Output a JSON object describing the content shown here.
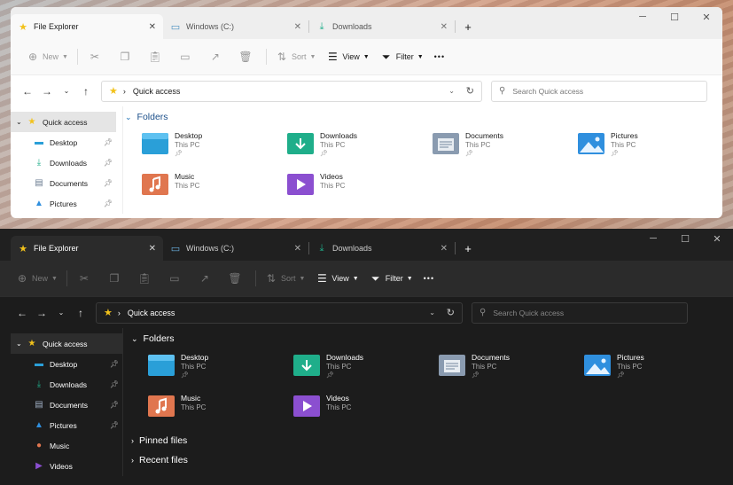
{
  "tabs": [
    {
      "label": "File Explorer",
      "icon": "star-icon",
      "active": true
    },
    {
      "label": "Windows (C:)",
      "icon": "drive-icon",
      "active": false
    },
    {
      "label": "Downloads",
      "icon": "download-icon",
      "active": false
    }
  ],
  "toolbar": {
    "new_label": "New",
    "sort_label": "Sort",
    "view_label": "View",
    "filter_label": "Filter",
    "more_label": "•••"
  },
  "address": {
    "location": "Quick access",
    "search_placeholder": "Search Quick access"
  },
  "sidebar": {
    "root": "Quick access",
    "items_light": [
      {
        "label": "Desktop",
        "icon": "desktop-icon"
      },
      {
        "label": "Downloads",
        "icon": "download-icon"
      },
      {
        "label": "Documents",
        "icon": "document-icon"
      },
      {
        "label": "Pictures",
        "icon": "pictures-icon"
      }
    ],
    "items_dark": [
      {
        "label": "Desktop",
        "icon": "desktop-icon"
      },
      {
        "label": "Downloads",
        "icon": "download-icon"
      },
      {
        "label": "Documents",
        "icon": "document-icon"
      },
      {
        "label": "Pictures",
        "icon": "pictures-icon"
      },
      {
        "label": "Music",
        "icon": "music-icon"
      },
      {
        "label": "Videos",
        "icon": "videos-icon"
      }
    ]
  },
  "main": {
    "folders_header": "Folders",
    "pinned_header": "Pinned files",
    "recent_header": "Recent files",
    "folders": [
      {
        "name": "Desktop",
        "location": "This PC",
        "pinned": true,
        "color": "#2a9fd8"
      },
      {
        "name": "Downloads",
        "location": "This PC",
        "pinned": true,
        "color": "#1fae8a"
      },
      {
        "name": "Documents",
        "location": "This PC",
        "pinned": true,
        "color": "#8a9bb0"
      },
      {
        "name": "Pictures",
        "location": "This PC",
        "pinned": true,
        "color": "#2f8fde"
      },
      {
        "name": "Music",
        "location": "This PC",
        "pinned": false,
        "color": "#e0764f"
      },
      {
        "name": "Videos",
        "location": "This PC",
        "pinned": false,
        "color": "#8b4fd0"
      }
    ]
  },
  "colors": {
    "star": "#f2c21b",
    "download_green": "#1fae8a"
  }
}
